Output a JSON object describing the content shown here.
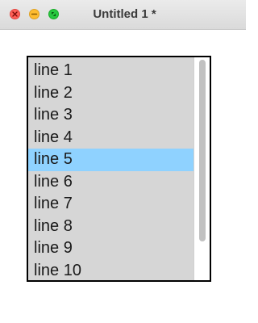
{
  "window": {
    "title": "Untitled 1 *"
  },
  "listbox": {
    "selected_index": 4,
    "items": [
      {
        "label": "line 1"
      },
      {
        "label": "line 2"
      },
      {
        "label": "line 3"
      },
      {
        "label": "line 4"
      },
      {
        "label": "line 5"
      },
      {
        "label": "line 6"
      },
      {
        "label": "line 7"
      },
      {
        "label": "line 8"
      },
      {
        "label": "line 9"
      },
      {
        "label": "line 10"
      }
    ]
  },
  "colors": {
    "selection": "#8fd2ff",
    "list_background": "#d6d6d6",
    "close_button": "#fe5f57",
    "minimize_button": "#febc2e",
    "maximize_button": "#28c840"
  },
  "icons": {
    "close": "close-icon",
    "minimize": "minimize-icon",
    "maximize": "maximize-icon"
  }
}
